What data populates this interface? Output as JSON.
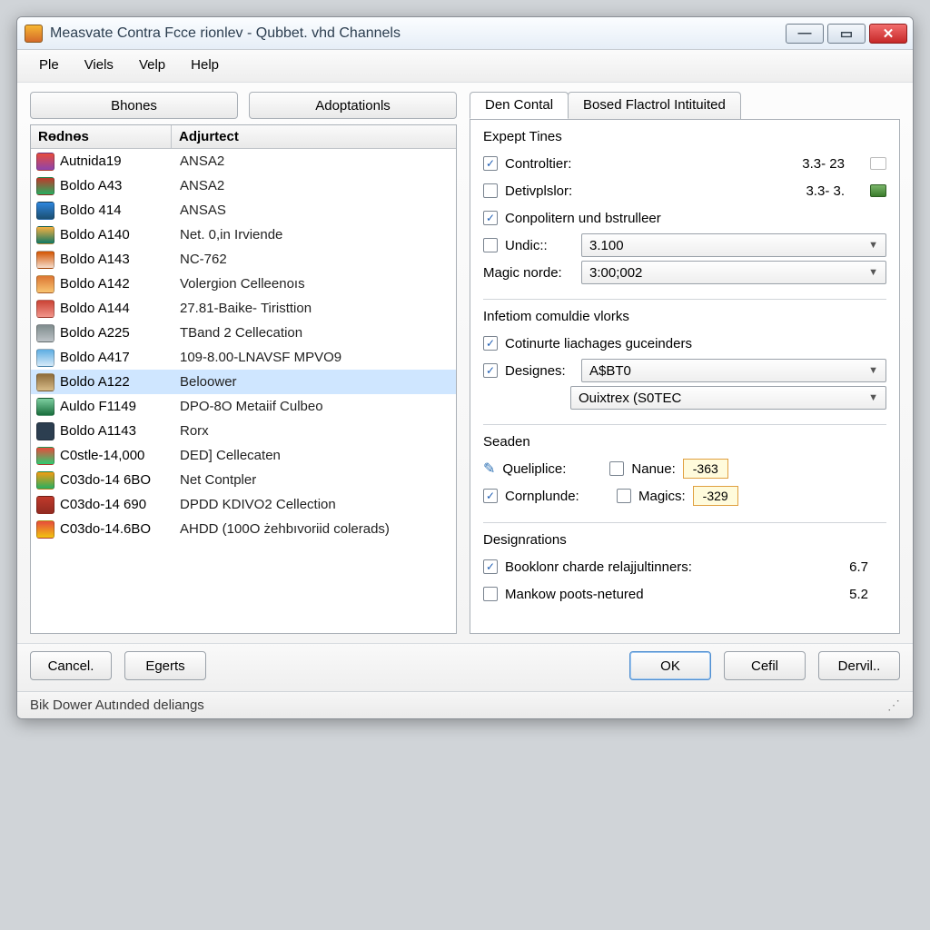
{
  "window": {
    "title": "Measvate Contra Fcce rionlev - Qubbet. vhd Channels"
  },
  "menu": {
    "items": [
      "Ple",
      "Viels",
      "Velp",
      "Help"
    ]
  },
  "left": {
    "buttons": {
      "b1": "Bhones",
      "b2": "Adoptationls"
    },
    "col1": "Rɵdnɵs",
    "col2": "Adjurtect",
    "rows": [
      {
        "name": "Autnida19",
        "val": "ANSA2",
        "icon": "ic1"
      },
      {
        "name": "Boldo A43",
        "val": "ANSA2",
        "icon": "ic2"
      },
      {
        "name": "Boldo 414",
        "val": "ANSAS",
        "icon": "ic3"
      },
      {
        "name": "Boldo A140",
        "val": "Net. 0,in Irviende",
        "icon": "ic4"
      },
      {
        "name": "Boldo A143",
        "val": "NC-762",
        "icon": "ic5"
      },
      {
        "name": "Boldo A142",
        "val": "Volergion Celleenoıs",
        "icon": "ic6"
      },
      {
        "name": "Boldo A144",
        "val": "27.81-Baike- Tiristtion",
        "icon": "ic7"
      },
      {
        "name": "Boldo A225",
        "val": "TBand 2 Cellecation",
        "icon": "ic8"
      },
      {
        "name": "Boldo A417",
        "val": "109-8.00-LNAVSF MPVO9",
        "icon": "ic9"
      },
      {
        "name": "Boldo A122",
        "val": "Beloower",
        "icon": "ic10",
        "selected": true
      },
      {
        "name": "Auldo F1149",
        "val": "DPO-8O Metaiif Culbeo",
        "icon": "ic11"
      },
      {
        "name": "Boldo A1143",
        "val": "Rorx",
        "icon": "ic12"
      },
      {
        "name": "C0stle-14,000",
        "val": "DED] Cellecaten",
        "icon": "ic13"
      },
      {
        "name": "C03do-14 6BO",
        "val": "Net Contpler",
        "icon": "ic14"
      },
      {
        "name": "C03do-14 690",
        "val": "DPDD KDIVO2 Cellection",
        "icon": "ic15"
      },
      {
        "name": "C03do-14.6BO",
        "val": "AHDD (100O żehbıvoriid colerads)",
        "icon": "ic16"
      }
    ]
  },
  "tabs": {
    "t1": "Den Contal",
    "t2": "Bosed Flactrol Intituited"
  },
  "expept": {
    "title": "Expept Tines",
    "controltier": "Controltier:",
    "controltier_val": "3.3-  23",
    "detivplslor": "Detivplslor:",
    "detivplslor_val": "3.3-  3.",
    "conpolitern": "Conpolitern und bstrulleer",
    "undic": "Undic::",
    "undic_val": "3.100",
    "magic": "Magic norde:",
    "magic_val": "3:00;002"
  },
  "infetiom": {
    "title": "Infetiom comuldie vlorks",
    "cotinurte": "Cotinurte liachages guceinders",
    "designes": "Designes:",
    "designes_val": "A$BT0",
    "ouixtrex": "Ouixtrex (S0TEC"
  },
  "seaden": {
    "title": "Seaden",
    "queliplice": "Queliplice:",
    "nanue": "Nanue:",
    "nanue_val": "-363",
    "cornplunde": "Cornplunde:",
    "magics": "Magics:",
    "magics_val": "-329"
  },
  "desig": {
    "title": "Designɾations",
    "boakloor": "Booklonr charde relajjultinners:",
    "boakloor_val": "6.7",
    "mankow": "Mankow poots-netured",
    "mankow_val": "5.2"
  },
  "bottom": {
    "cancel": "Cancel.",
    "egerts": "Egerts",
    "ok": "OK",
    "cefil": "Cefil",
    "dervil": "Dervil.."
  },
  "status": "Bik Dower Autınded deliangs"
}
